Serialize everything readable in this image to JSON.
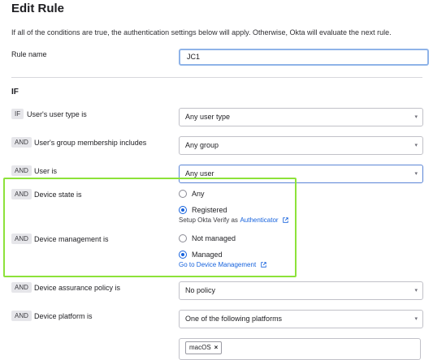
{
  "page": {
    "title": "Edit Rule",
    "subtitle": "If all of the conditions are true, the authentication settings below will apply. Otherwise, Okta will evaluate the next rule."
  },
  "rule_name": {
    "label": "Rule name",
    "value": "JC1"
  },
  "if_section": {
    "heading": "IF",
    "user_type": {
      "tag": "IF",
      "label": "User's user type is",
      "value": "Any user type"
    },
    "group_membership": {
      "tag": "AND",
      "label": "User's group membership includes",
      "value": "Any group"
    },
    "user_is": {
      "tag": "AND",
      "label": "User is",
      "value": "Any user"
    },
    "device_state": {
      "tag": "AND",
      "label": "Device state is",
      "options": [
        "Any",
        "Registered"
      ],
      "selected": "Registered",
      "hint_prefix": "Setup Okta Verify as",
      "hint_link": "Authenticator"
    },
    "device_management": {
      "tag": "AND",
      "label": "Device management is",
      "options": [
        "Not managed",
        "Managed"
      ],
      "selected": "Managed",
      "link": "Go to Device Management"
    },
    "assurance_policy": {
      "tag": "AND",
      "label": "Device assurance policy is",
      "value": "No policy"
    },
    "device_platform": {
      "tag": "AND",
      "label": "Device platform is",
      "value": "One of the following platforms",
      "chips": [
        "macOS"
      ]
    }
  },
  "icons": {
    "caret": "chevron-down-icon",
    "external": "external-link-icon",
    "chip_remove": "close-icon"
  },
  "colors": {
    "accent": "#1662dd",
    "highlight": "#8de23a",
    "tag_bg": "#e6e6ea"
  }
}
